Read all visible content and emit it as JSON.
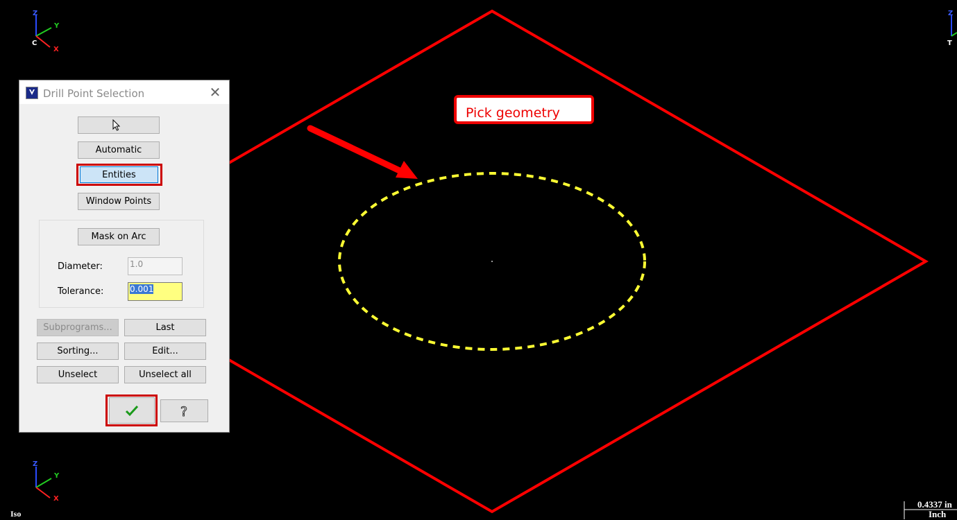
{
  "viewport": {
    "view_name": "Iso",
    "scale_value": "0.4337 in",
    "scale_unit": "Inch",
    "callout": "Pick geometry",
    "colors": {
      "background": "#000000",
      "part_outline": "#ff0000",
      "selected_circle": "#ffff33",
      "arrow": "#ff0000"
    },
    "axes": {
      "top_left": {
        "z": "Z",
        "y": "Y",
        "x": "X",
        "origin": "C"
      },
      "bottom_left": {
        "z": "Z",
        "y": "Y",
        "x": "X"
      },
      "top_right": {
        "z": "Z",
        "origin": "T"
      }
    }
  },
  "dialog": {
    "title": "Drill Point Selection",
    "close_icon": "close-icon",
    "pointer_icon": "mouse-pointer-icon",
    "buttons": {
      "automatic": "Automatic",
      "entities": "Entities",
      "window_points": "Window Points",
      "mask_on_arc": "Mask on Arc",
      "subprograms": "Subprograms...",
      "last": "Last",
      "sorting": "Sorting...",
      "edit": "Edit...",
      "unselect": "Unselect",
      "unselect_all": "Unselect all",
      "ok_icon": "checkmark-icon",
      "help_icon": "question-mark-icon"
    },
    "fields": {
      "diameter_label": "Diameter:",
      "diameter_value": "1.0",
      "tolerance_label": "Tolerance:",
      "tolerance_value": "0.001"
    }
  }
}
